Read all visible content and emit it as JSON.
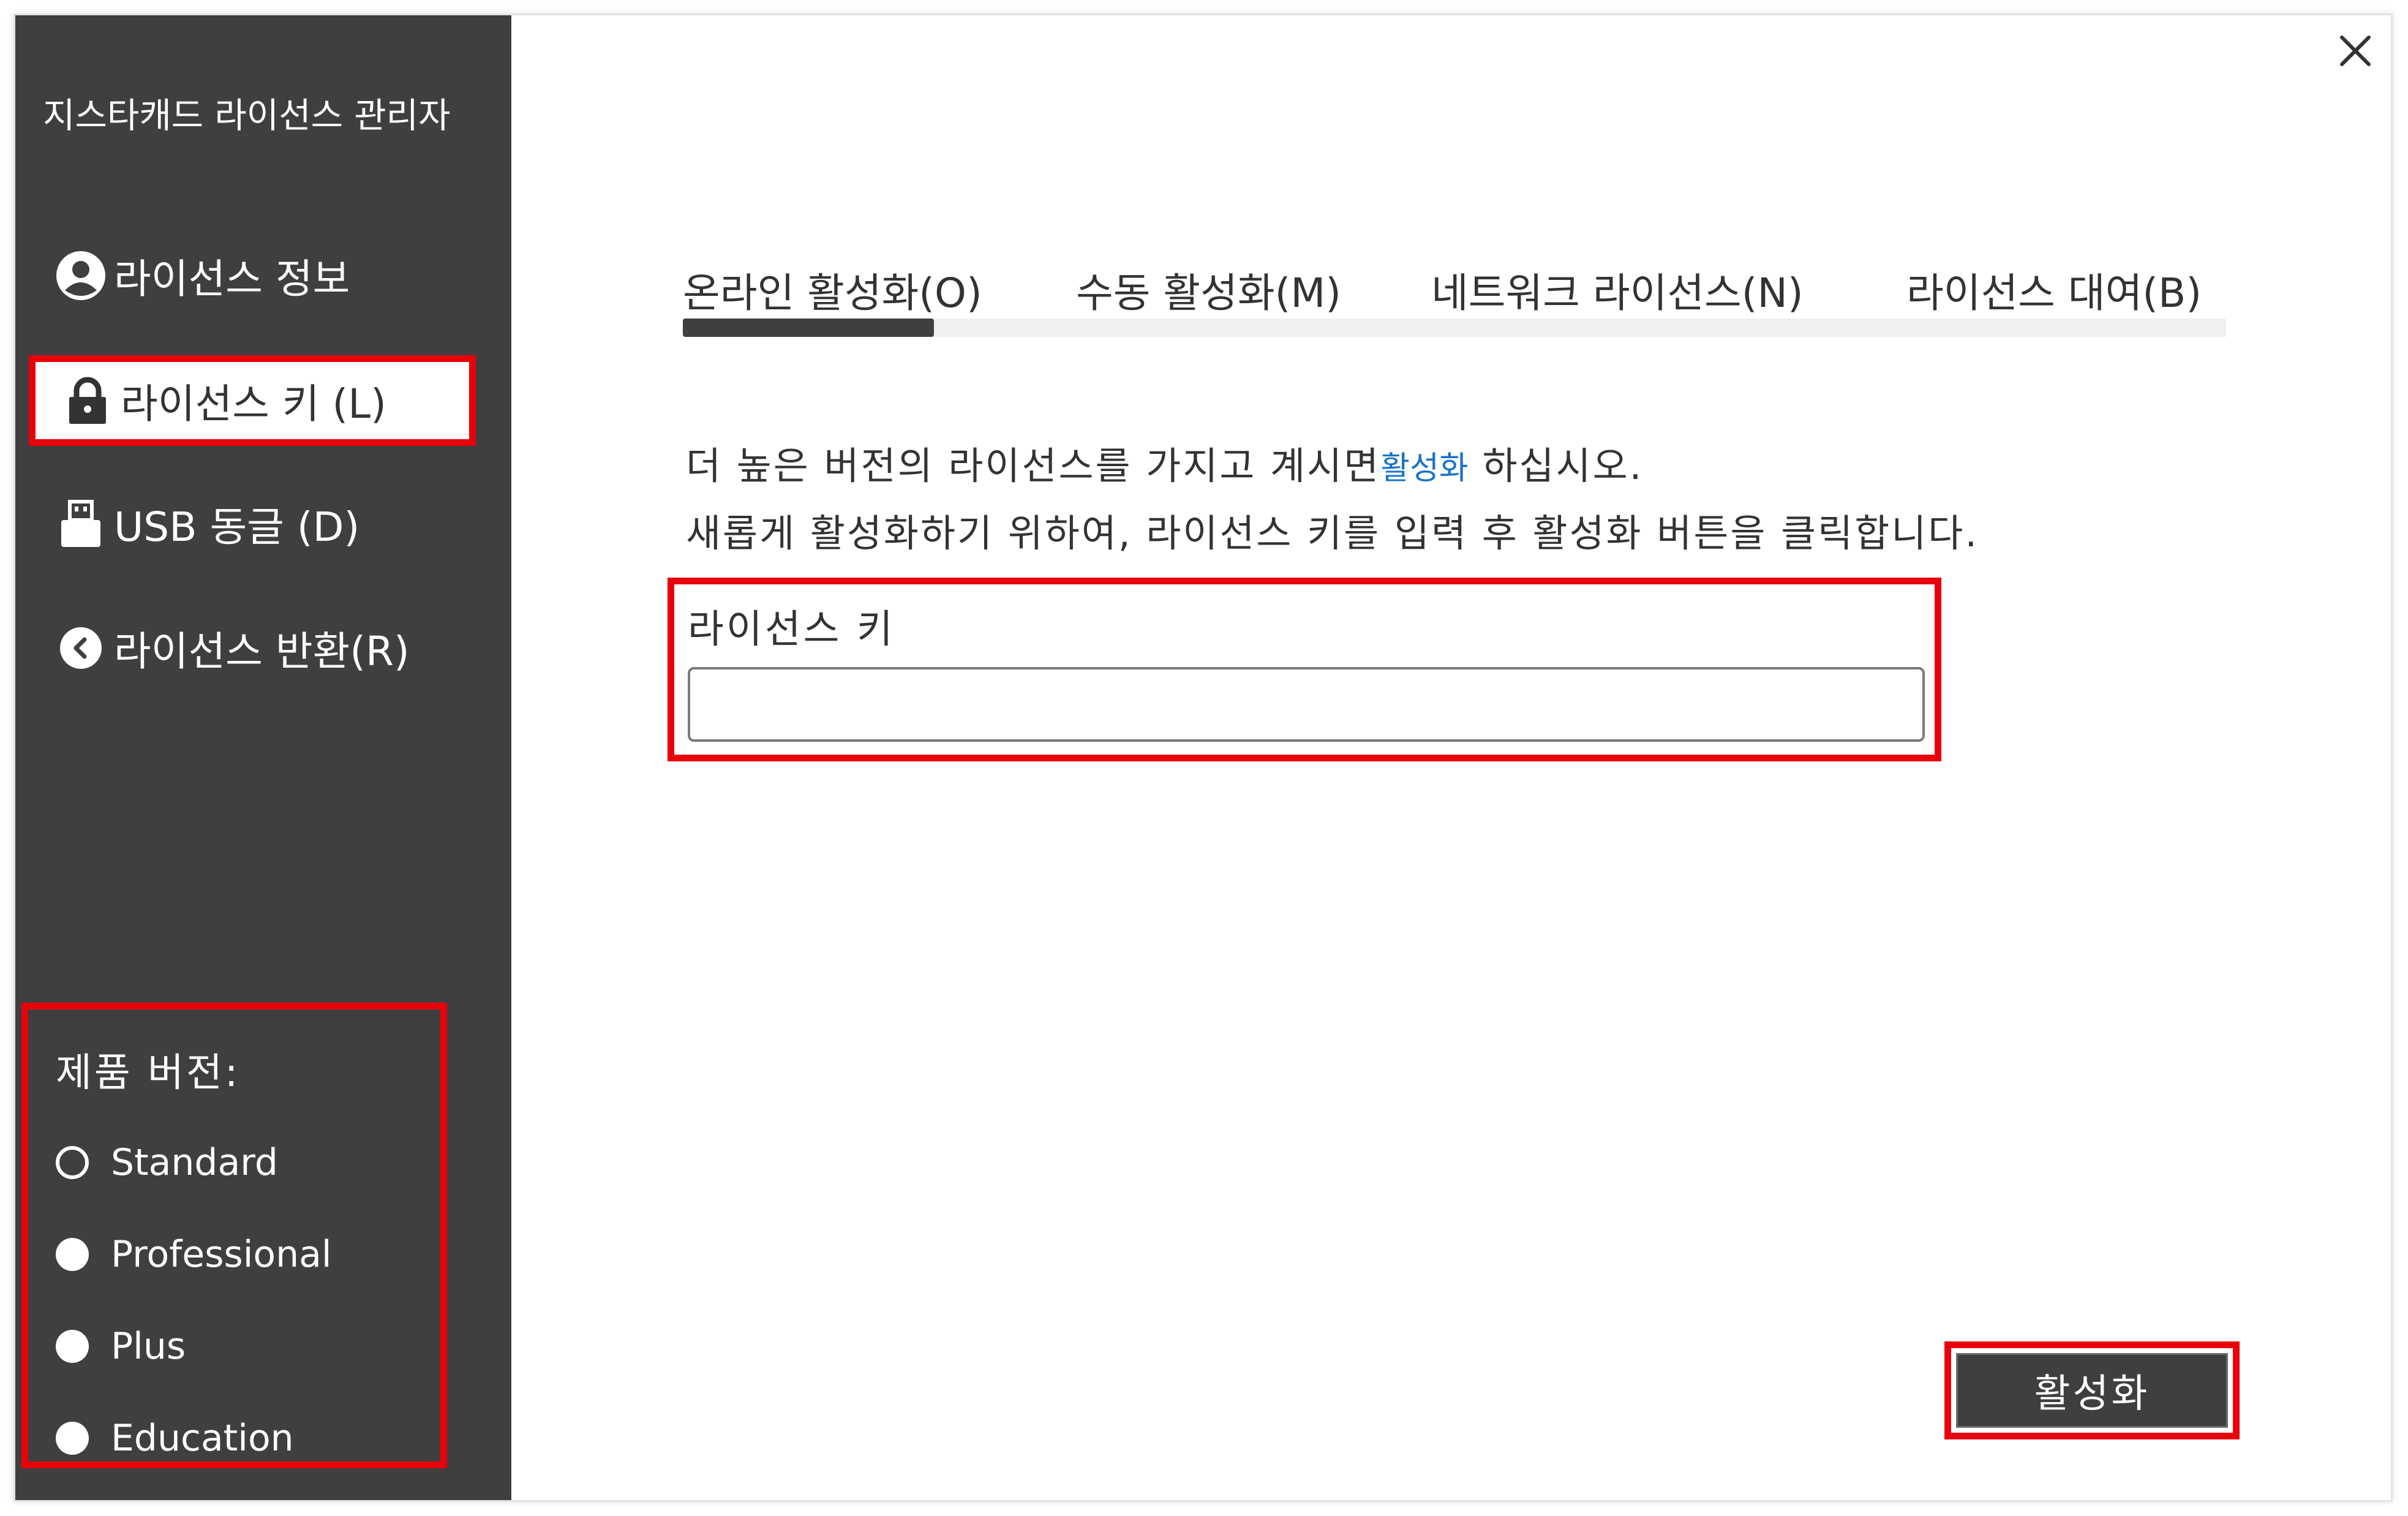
{
  "app": {
    "title": "지스타캐드 라이선스 관리자"
  },
  "sidebar": {
    "items": [
      {
        "label": "라이선스 정보",
        "icon": "user-circle-icon"
      },
      {
        "label": "라이선스 키 (L)",
        "icon": "lock-icon",
        "active": true
      },
      {
        "label": "USB 동글 (D)",
        "icon": "usb-icon"
      },
      {
        "label": "라이선스 반환(R)",
        "icon": "back-circle-icon"
      }
    ],
    "version": {
      "label": "제품 버전:",
      "options": [
        {
          "label": "Standard",
          "selected": true
        },
        {
          "label": "Professional",
          "selected": false
        },
        {
          "label": "Plus",
          "selected": false
        },
        {
          "label": "Education",
          "selected": false
        }
      ]
    }
  },
  "tabs": [
    {
      "label": "온라인 활성화(O)",
      "active": true
    },
    {
      "label": "수동 활성화(M)"
    },
    {
      "label": "네트워크 라이선스(N)"
    },
    {
      "label": "라이선스 대여(B)"
    }
  ],
  "main": {
    "desc1_prefix": "더 높은 버전의 라이선스를 가지고 계시면",
    "desc1_link": "활성화",
    "desc1_suffix": " 하십시오.",
    "desc2": "새롭게 활성화하기 위하여, 라이선스 키를 입력 후 활성화 버튼을 클릭합니다.",
    "key_label": "라이선스 키",
    "key_value": "",
    "activate_label": "활성화"
  },
  "colors": {
    "sidebar_bg": "#3f3f3f",
    "highlight": "#e8000b",
    "link": "#1a73c8"
  }
}
